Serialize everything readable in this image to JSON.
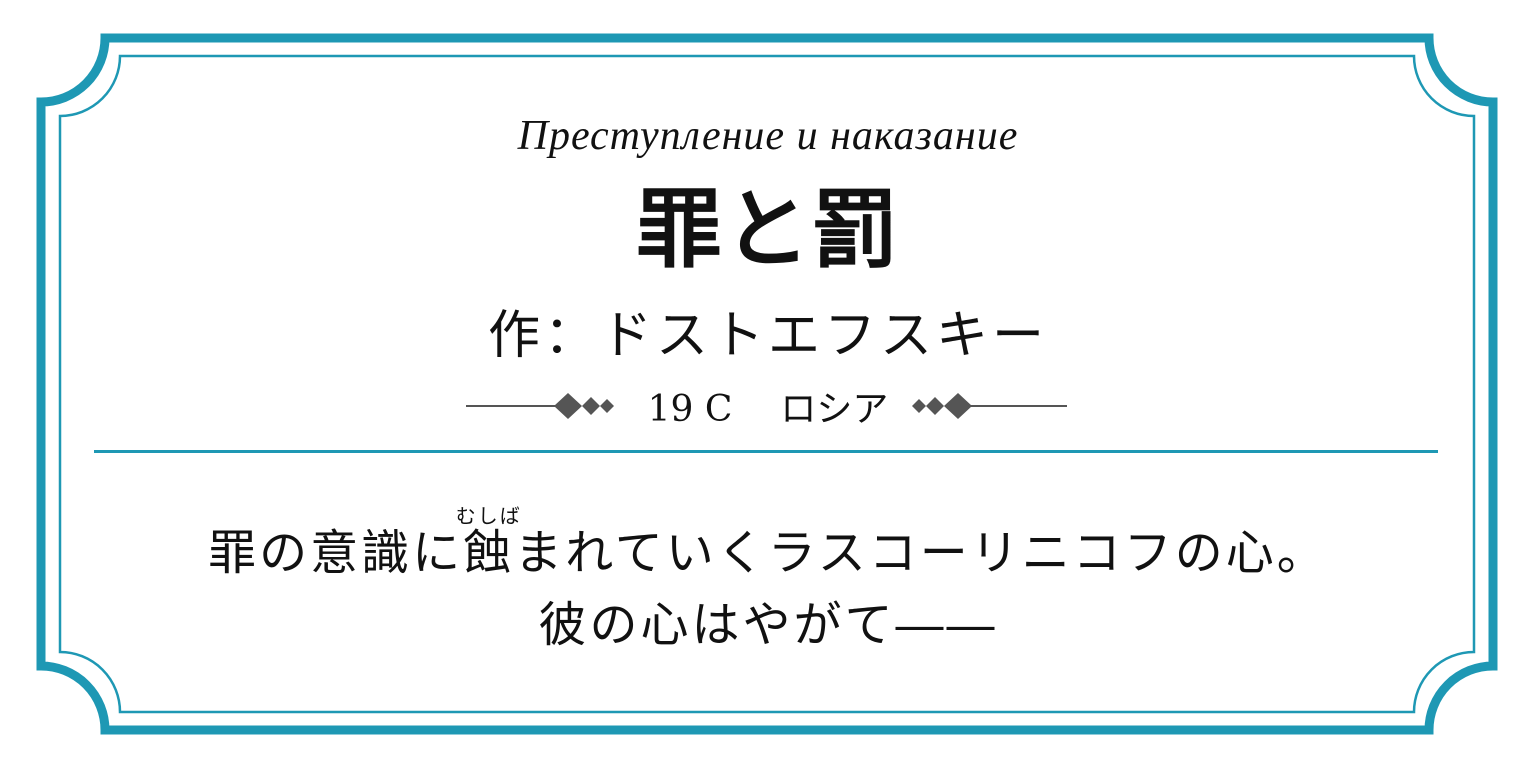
{
  "card": {
    "original_title": "Преступление и наказание",
    "title": "罪と罰",
    "author": "作：ドストエフスキー",
    "era": "19 C",
    "country": "ロシア",
    "description_part1": "罪の意識に",
    "description_ruby_base": "蝕",
    "description_ruby_reading": "むしば",
    "description_part2": "まれていくラスコーリニコフの心。",
    "description_line2": "彼の心はやがて――"
  },
  "colors": {
    "frame": "#1e98b4",
    "ornament": "#555555",
    "text": "#111111"
  }
}
